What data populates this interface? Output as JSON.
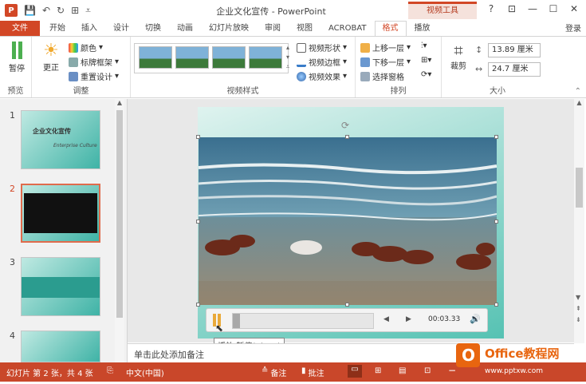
{
  "window": {
    "title": "企业文化宣传 - PowerPoint",
    "context_tab_group": "视频工具",
    "controls": [
      "?",
      "⊡",
      "—",
      "☐",
      "✕"
    ],
    "login": "登录"
  },
  "tabs": [
    "文件",
    "开始",
    "插入",
    "设计",
    "切换",
    "动画",
    "幻灯片放映",
    "审阅",
    "视图",
    "ACROBAT",
    "格式",
    "播放"
  ],
  "active_tab": "格式",
  "ribbon": {
    "preview": {
      "button": "暂停",
      "group": "预览"
    },
    "adjust": {
      "corrections": "更正",
      "color": "颜色",
      "poster_frame": "标牌框架",
      "reset_design": "重置设计",
      "group": "调整"
    },
    "video_styles": {
      "group": "视频样式",
      "shape": "视频形状",
      "border": "视频边框",
      "effects": "视频效果"
    },
    "arrange": {
      "group": "排列",
      "bring_forward": "上移一层",
      "send_backward": "下移一层",
      "selection_pane": "选择窗格"
    },
    "size": {
      "group": "大小",
      "crop": "裁剪",
      "height": "13.89 厘米",
      "width": "24.7 厘米"
    }
  },
  "slides": [
    {
      "number": "1",
      "title": "企业文化宣传",
      "subtitle": "Enterprise Culture"
    },
    {
      "number": "2"
    },
    {
      "number": "3"
    },
    {
      "number": "4"
    }
  ],
  "media_controls": {
    "time": "00:03.33",
    "progress": 0.05
  },
  "tooltip": "播放/暂停(Alt+P)",
  "notes_placeholder": "单击此处添加备注",
  "status": {
    "slide_info": "幻灯片 第 2 张，共 4 张",
    "language": "中文(中国)",
    "notes": "备注",
    "comments": "批注",
    "zoom_minus": "−",
    "zoom_plus": "+"
  },
  "watermark": {
    "brand": "Office教程网",
    "url": "www.pptxw.com"
  },
  "colors": {
    "accent": "#d24726",
    "status_bar": "#c9472a",
    "teal": "#3fb3a6"
  }
}
